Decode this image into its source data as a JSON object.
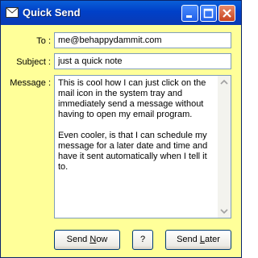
{
  "window": {
    "title": "Quick Send"
  },
  "titlebar_buttons": {
    "minimize_icon": "minimize-icon",
    "maximize_icon": "maximize-icon",
    "close_icon": "close-icon"
  },
  "form": {
    "to_label": "To :",
    "to_value": "me@behappydammit.com",
    "subject_label": "Subject :",
    "subject_value": "just a quick note",
    "message_label": "Message :",
    "message_value": "This is cool how I can just click on the mail icon in the system tray and immediately send a message without having to open my email program.\n\nEven cooler, is that I can schedule my message for a later date and time and have it sent automatically when I tell it to."
  },
  "buttons": {
    "send_now": {
      "before": "Send ",
      "mnemonic": "N",
      "after": "ow"
    },
    "help": "?",
    "send_later": {
      "before": "Send ",
      "mnemonic": "L",
      "after": "ater"
    }
  },
  "colors": {
    "window_bg": "#ffff99",
    "titlebar": "#0040c8",
    "field_border": "#7f9db9"
  }
}
